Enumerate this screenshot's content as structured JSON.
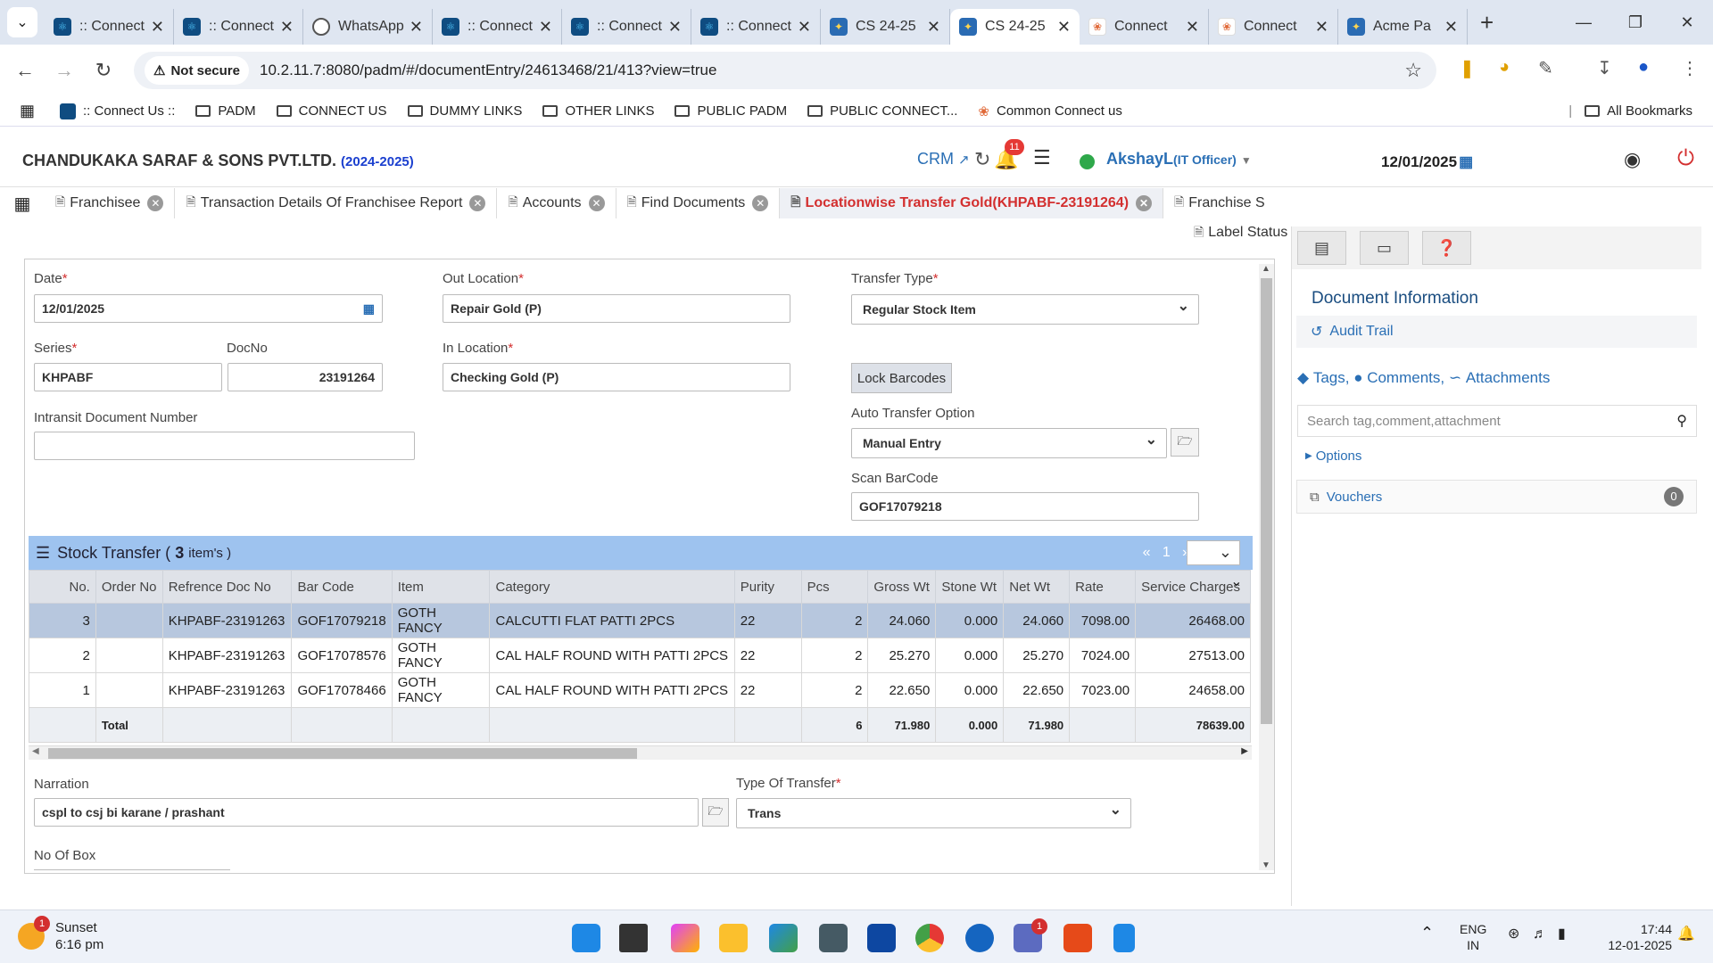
{
  "browser": {
    "tabs": [
      {
        "title": ":: Connect",
        "icon": "react-icon"
      },
      {
        "title": ":: Connect",
        "icon": "react-icon"
      },
      {
        "title": "WhatsApp",
        "icon": "globe-icon"
      },
      {
        "title": ":: Connect",
        "icon": "react-icon"
      },
      {
        "title": ":: Connect",
        "icon": "react-icon"
      },
      {
        "title": ":: Connect",
        "icon": "react-icon"
      },
      {
        "title": "CS 24-25",
        "icon": "cs-icon"
      },
      {
        "title": "CS 24-25",
        "icon": "cs-icon",
        "active": true
      },
      {
        "title": "Connect",
        "icon": "orange-icon"
      },
      {
        "title": "Connect",
        "icon": "orange-icon"
      },
      {
        "title": "Acme Pa",
        "icon": "cs-icon"
      }
    ],
    "not_secure": "Not secure",
    "url": "10.2.11.7:8080/padm/#/documentEntry/24613468/21/413?view=true",
    "bookmarks": [
      ":: Connect Us ::",
      "PADM",
      "CONNECT US",
      "DUMMY LINKS",
      "OTHER LINKS",
      "PUBLIC PADM",
      "PUBLIC CONNECT...",
      "Common Connect us"
    ],
    "all_bookmarks": "All Bookmarks"
  },
  "app": {
    "company": "CHANDUKAKA SARAF & SONS PVT.LTD.",
    "year": "(2024-2025)",
    "crm": "CRM",
    "notif_count": "11",
    "user": "AkshayL",
    "role": "(IT Officer)",
    "date": "12/01/2025",
    "tabs": [
      "Franchisee",
      "Transaction Details Of Franchisee Report",
      "Accounts",
      "Find Documents",
      "Locationwise Transfer Gold(KHPABF-23191264)",
      "Franchise S"
    ],
    "label_status": "Label Status"
  },
  "form": {
    "date_label": "Date",
    "date": "12/01/2025",
    "out_location_label": "Out Location",
    "out_location": "Repair Gold (P)",
    "transfer_type_label": "Transfer Type",
    "transfer_type": "Regular Stock Item",
    "series_label": "Series",
    "series": "KHPABF",
    "docno_label": "DocNo",
    "docno": "23191264",
    "in_location_label": "In Location",
    "in_location": "Checking Gold (P)",
    "lock_barcodes": "Lock Barcodes",
    "intransit_label": "Intransit Document Number",
    "intransit": "",
    "auto_transfer_label": "Auto Transfer Option",
    "auto_transfer": "Manual Entry",
    "scan_barcode_label": "Scan BarCode",
    "scan_barcode": "GOF17079218",
    "narration_label": "Narration",
    "narration": "cspl to csj bi karane / prashant",
    "type_of_transfer_label": "Type Of Transfer",
    "type_of_transfer": "Trans",
    "no_of_box_label": "No Of Box"
  },
  "grid": {
    "title": "Stock Transfer (",
    "count": "3",
    "items": "item's )",
    "page": "1",
    "columns": [
      "No.",
      "Order No",
      "Refrence Doc No",
      "Bar Code",
      "Item",
      "Category",
      "Purity",
      "Pcs",
      "Gross Wt",
      "Stone Wt",
      "Net Wt",
      "Rate",
      "Service Charges"
    ],
    "rows": [
      [
        "3",
        "",
        "KHPABF-23191263",
        "GOF17079218",
        "GOTH FANCY",
        "CALCUTTI FLAT PATTI 2PCS",
        "22",
        "2",
        "24.060",
        "0.000",
        "24.060",
        "7098.00",
        "26468.00"
      ],
      [
        "2",
        "",
        "KHPABF-23191263",
        "GOF17078576",
        "GOTH FANCY",
        "CAL HALF ROUND WITH PATTI 2PCS",
        "22",
        "2",
        "25.270",
        "0.000",
        "25.270",
        "7024.00",
        "27513.00"
      ],
      [
        "1",
        "",
        "KHPABF-23191263",
        "GOF17078466",
        "GOTH FANCY",
        "CAL HALF ROUND WITH PATTI 2PCS",
        "22",
        "2",
        "22.650",
        "0.000",
        "22.650",
        "7023.00",
        "24658.00"
      ]
    ],
    "total": {
      "label": "Total",
      "pcs": "6",
      "gross": "71.980",
      "stone": "0.000",
      "net": "71.980",
      "service": "78639.00"
    }
  },
  "side": {
    "title": "Document Information",
    "audit": "Audit Trail",
    "tags": "Tags,",
    "comments": "Comments,",
    "attachments": "Attachments",
    "search_placeholder": "Search tag,comment,attachment",
    "options": "Options",
    "vouchers": "Vouchers",
    "vouchers_count": "0"
  },
  "taskbar": {
    "weather_title": "Sunset",
    "weather_time": "6:16 pm",
    "weather_badge": "1",
    "lang": "ENG",
    "region": "IN",
    "time": "17:44",
    "date": "12-01-2025",
    "teams_badge": "1"
  }
}
